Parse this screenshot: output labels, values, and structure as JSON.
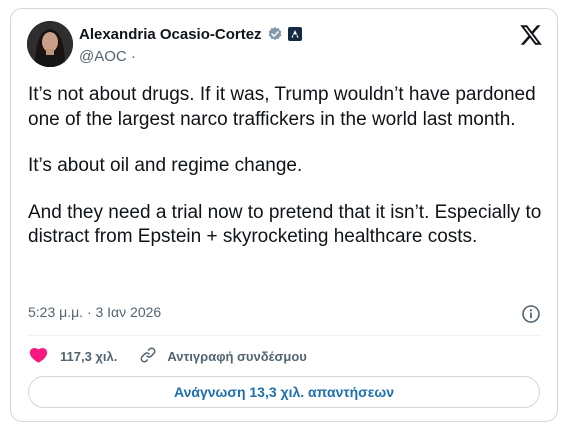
{
  "author": {
    "name": "Alexandria Ocasio-Cortez",
    "handle": "@AOC",
    "handle_separator": "·"
  },
  "tweet": {
    "paragraphs": [
      "It’s not about drugs. If it was, Trump wouldn’t have pardoned one of the largest narco traffickers in the world last month.",
      "It’s about oil and regime change.",
      "And they need a trial now to pretend that it isn’t. Especially to distract from Epstein + skyrocketing healthcare costs."
    ],
    "timestamp": "5:23 μ.μ. · 3 Ιαν 2026"
  },
  "actions": {
    "like_count": "117,3 χιλ.",
    "copy_link_label": "Αντιγραφή συνδέσμου",
    "read_replies_label": "Ανάγνωση 13,3 χιλ. απαντήσεων"
  },
  "icons": {
    "verified": "verified-badge-icon",
    "government": "government-affiliation-icon",
    "platform": "x-logo-icon",
    "info": "info-icon",
    "like": "heart-icon",
    "link": "link-icon"
  },
  "colors": {
    "like": "#f91880",
    "link_text": "#1d6fb0",
    "secondary_text": "#536471",
    "border": "#cfd9de"
  }
}
